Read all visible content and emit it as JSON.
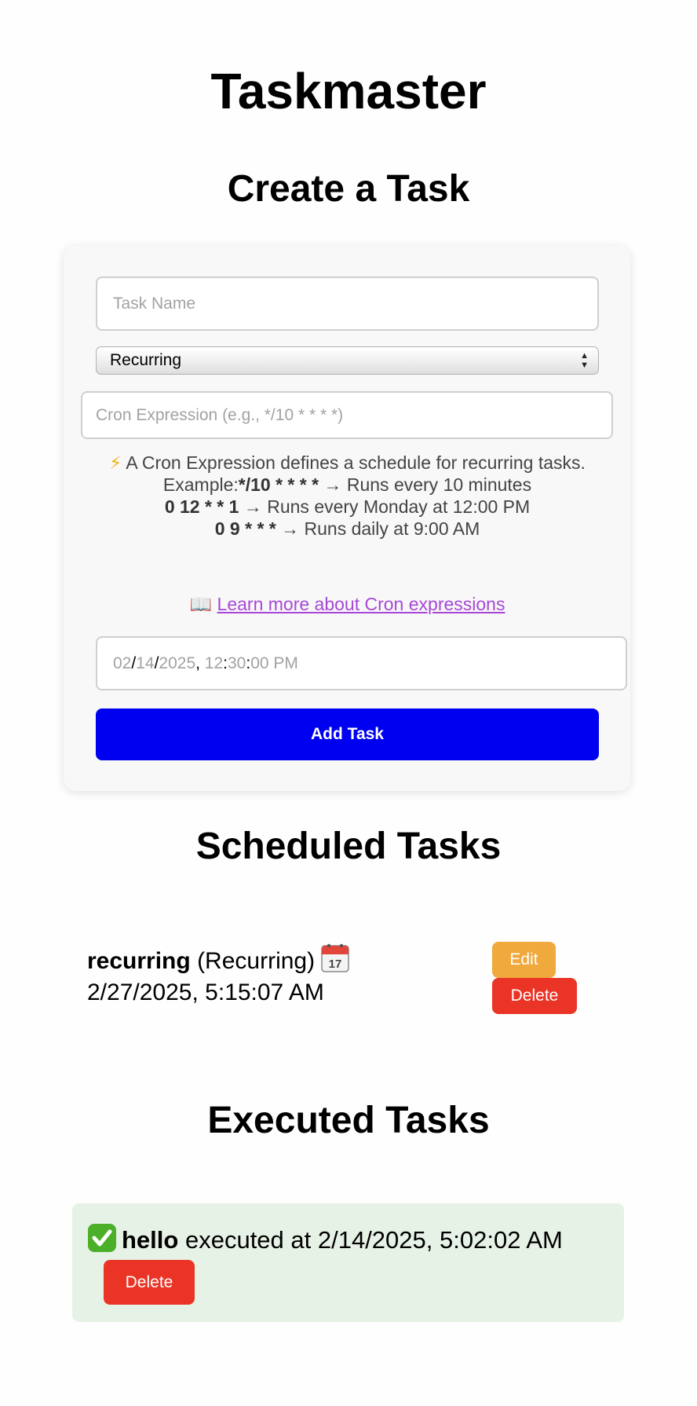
{
  "app": {
    "title": "Taskmaster"
  },
  "create": {
    "heading": "Create a Task",
    "task_name_placeholder": "Task Name",
    "task_type_selected": "Recurring",
    "cron_placeholder": "Cron Expression (e.g., */10 * * * *)",
    "help": {
      "bolt_icon": "lightning-icon",
      "intro": "A Cron Expression defines a schedule for recurring tasks.",
      "examples": [
        {
          "prefix": "Example:",
          "expr": "*/10 * * * *",
          "desc": "→ Runs every 10 minutes"
        },
        {
          "prefix": "",
          "expr": "0 12 * * 1",
          "desc": "→ Runs every Monday at 12:00 PM"
        },
        {
          "prefix": "",
          "expr": "0 9 * * *",
          "desc": "→ Runs daily at 9:00 AM"
        }
      ]
    },
    "learn_more": {
      "icon": "book-icon",
      "text": "Learn more about Cron expressions"
    },
    "datetime": {
      "month": "02",
      "day": "14",
      "year": "2025",
      "hour": "12",
      "minute": "30",
      "second": "00",
      "ampm": "PM"
    },
    "add_button": "Add Task"
  },
  "scheduled": {
    "heading": "Scheduled Tasks",
    "tasks": [
      {
        "name": "recurring",
        "type": "(Recurring)",
        "icon": "calendar-icon",
        "time": "2/27/2025, 5:15:07 AM",
        "edit_label": "Edit",
        "delete_label": "Delete"
      }
    ]
  },
  "executed": {
    "heading": "Executed Tasks",
    "tasks": [
      {
        "icon": "check-mark-icon",
        "name": "hello",
        "text": "executed at 2/14/2025, 5:02:02 AM",
        "delete_label": "Delete"
      }
    ]
  },
  "colors": {
    "add_button": "#0000f0",
    "edit_button": "#efa93c",
    "delete_button": "#ea3426",
    "executed_bg": "#e7f2e6",
    "link": "#a748d8"
  }
}
